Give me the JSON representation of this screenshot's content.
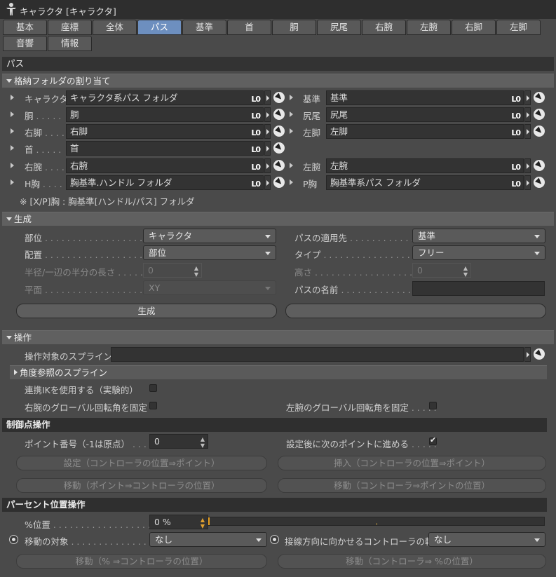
{
  "window": {
    "title": "キャラクタ [キャラクタ]"
  },
  "tabs": [
    {
      "label": "基本"
    },
    {
      "label": "座標"
    },
    {
      "label": "全体"
    },
    {
      "label": "パス"
    },
    {
      "label": "基準"
    },
    {
      "label": "首"
    },
    {
      "label": "胴"
    },
    {
      "label": "尻尾"
    },
    {
      "label": "右腕"
    },
    {
      "label": "左腕"
    },
    {
      "label": "右脚"
    },
    {
      "label": "左脚"
    },
    {
      "label": "音響"
    },
    {
      "label": "情報"
    }
  ],
  "main_section": "パス",
  "folder_section": {
    "title": "格納フォルダの割り当て",
    "rows": [
      {
        "label": "キャラクタ",
        "value": "キャラクタ系パス フォルダ"
      },
      {
        "label": "基準",
        "value": "基準"
      },
      {
        "label": "胴",
        "value": "胴"
      },
      {
        "label": "尻尾",
        "value": "尻尾"
      },
      {
        "label": "右脚",
        "value": "右脚"
      },
      {
        "label": "左脚",
        "value": "左脚"
      },
      {
        "label": "首",
        "value": "首"
      },
      {
        "label": "右腕",
        "value": "右腕"
      },
      {
        "label": "左腕",
        "value": "左腕"
      },
      {
        "label": "H胸",
        "value": "胸基準.ハンドル フォルダ"
      },
      {
        "label": "P胸",
        "value": "胸基準系パス フォルダ"
      }
    ],
    "link_badge": "L0",
    "note": "※ [X/P]胸 : 胸基準[ハンドル/パス] フォルダ"
  },
  "generate_section": {
    "title": "生成",
    "part_label": "部位",
    "part_value": "キャラクタ",
    "target_label": "パスの適用先",
    "target_value": "基準",
    "placement_label": "配置",
    "placement_value": "部位",
    "type_label": "タイプ",
    "type_value": "フリー",
    "radius_label": "半径/一辺の半分の長さ",
    "radius_value": "0",
    "height_label": "高さ",
    "height_value": "0",
    "plane_label": "平面",
    "plane_value": "XY",
    "pathname_label": "パスの名前",
    "pathname_value": "",
    "generate_button": "生成",
    "second_button": ""
  },
  "operation_section": {
    "title": "操作",
    "spline_label": "操作対象のスプライン",
    "spline_value": "",
    "angle_spline": "角度参照のスプライン",
    "ik_label": "連携IKを使用する（実験的）",
    "ik_checked": false,
    "rarm_label": "右腕のグローバル回転角を固定",
    "rarm_checked": false,
    "larm_label": "左腕のグローバル回転角を固定",
    "larm_checked": false
  },
  "control_section": {
    "title": "制御点操作",
    "point_label": "ポイント番号（-1は原点）",
    "point_value": "0",
    "advance_label": "設定後に次のポイントに進める",
    "advance_checked": true,
    "btn_set": "設定（コントローラの位置⇒ポイント）",
    "btn_insert": "挿入（コントローラの位置⇒ポイント）",
    "btn_move_pc": "移動（ポイント⇒コントローラの位置）",
    "btn_move_cp": "移動（コントローラ⇒ポイントの位置）"
  },
  "percent_section": {
    "title": "パーセント位置操作",
    "pos_label": "%位置",
    "pos_value": "0 %",
    "pos_fraction": 0,
    "move_target_label": "移動の対象",
    "move_target_value": "なし",
    "tangent_label": "接線方向に向かせるコントローラの軸",
    "tangent_value": "なし",
    "btn_move_pc": "移動（% ⇒コントローラの位置）",
    "btn_move_cp": "移動（コントローラ⇒ %の位置）"
  },
  "icons": {
    "window": "character-figure-icon",
    "picker": "object-picker-icon",
    "expand": "expand-arrow-icon"
  }
}
